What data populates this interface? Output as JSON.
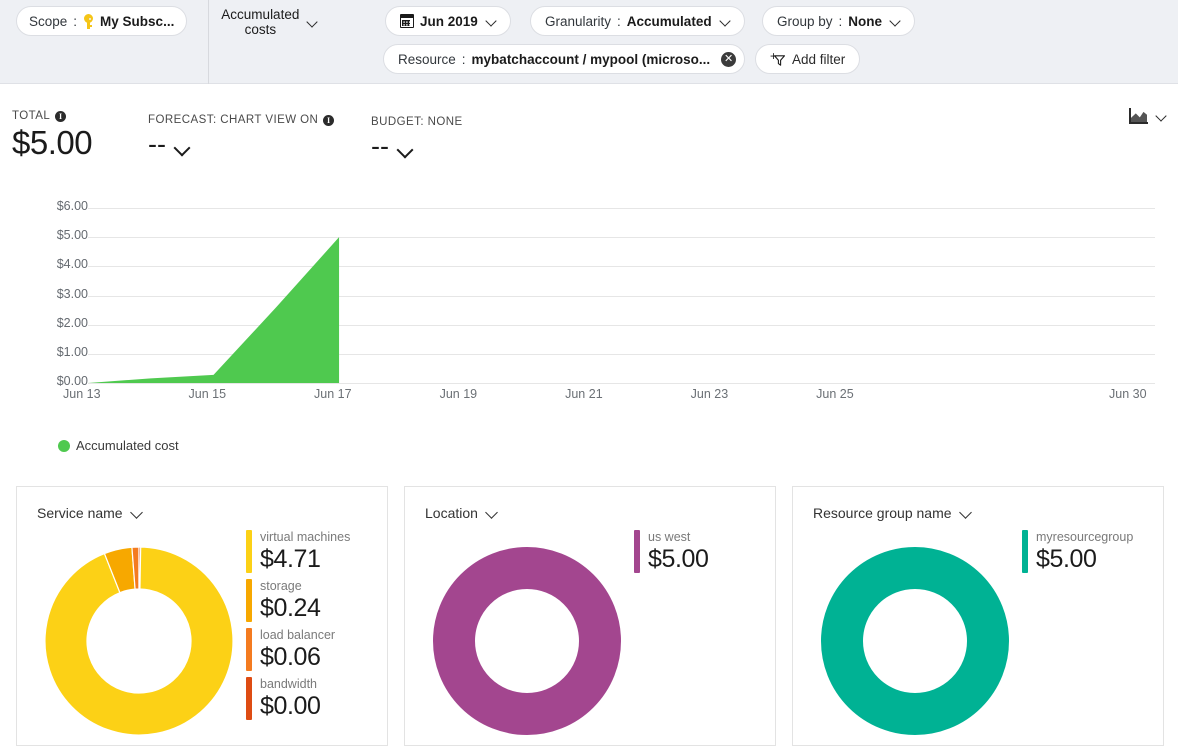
{
  "toolbar": {
    "scope": {
      "label": "Scope",
      "separator": ":",
      "value": "My Subsc...",
      "icon": "key-icon"
    },
    "view_button": {
      "label": "Accumulated costs",
      "icon": "chevron-down-icon"
    },
    "date_range": {
      "value": "Jun 2019",
      "icon": "calendar-icon"
    },
    "granularity": {
      "label": "Granularity",
      "separator": ":",
      "value": "Accumulated"
    },
    "group_by": {
      "label": "Group by",
      "separator": ":",
      "value": "None"
    },
    "resource_filter": {
      "label": "Resource",
      "separator": ":",
      "value": "mybatchaccount / mypool (microso...",
      "remove_icon": "✕"
    },
    "add_filter": {
      "label": "Add filter",
      "icon": "funnel-plus-icon"
    }
  },
  "kpis": {
    "total": {
      "caption": "TOTAL",
      "value": "$5.00",
      "info": "i"
    },
    "forecast": {
      "caption": "FORECAST: CHART VIEW ON",
      "value": "--",
      "info": "i"
    },
    "budget": {
      "caption": "BUDGET: NONE",
      "value": "--"
    }
  },
  "chart_type_selector": {
    "icon": "area-chart-icon",
    "chevron": "chevron-down-icon"
  },
  "chart_data": {
    "type": "area",
    "title": "",
    "xlabel": "",
    "ylabel": "",
    "ylim": [
      0,
      6
    ],
    "ytick_labels": [
      "$6.00",
      "$5.00",
      "$4.00",
      "$3.00",
      "$2.00",
      "$1.00",
      "$0.00"
    ],
    "ytick_values": [
      6,
      5,
      4,
      3,
      2,
      1,
      0
    ],
    "xtick_labels": [
      "Jun 13",
      "Jun 15",
      "Jun 17",
      "Jun 19",
      "Jun 21",
      "Jun 23",
      "Jun 25",
      "Jun 30"
    ],
    "xtick_days": [
      13,
      15,
      17,
      19,
      21,
      23,
      25,
      30
    ],
    "xlim_days": [
      13,
      30
    ],
    "grid": true,
    "legend_position": "bottom-left",
    "series": [
      {
        "name": "Accumulated cost",
        "color": "#4fc94f",
        "x": [
          13,
          14,
          15,
          16,
          17
        ],
        "values": [
          0.0,
          0.16,
          0.28,
          2.6,
          5.0
        ]
      }
    ],
    "legend": [
      {
        "label": "Accumulated cost",
        "color": "#4fc94f"
      }
    ]
  },
  "donut_cards": [
    {
      "title": "Service name",
      "chart_data": {
        "type": "pie",
        "categories": [
          "virtual machines",
          "storage",
          "load balancer",
          "bandwidth"
        ],
        "values": [
          4.71,
          0.24,
          0.06,
          0.0
        ],
        "value_labels": [
          "$4.71",
          "$0.24",
          "$0.06",
          "$0.00"
        ],
        "colors": [
          "#fcd116",
          "#f7a800",
          "#f47b20",
          "#de4c13"
        ],
        "total": 5.01
      }
    },
    {
      "title": "Location",
      "chart_data": {
        "type": "pie",
        "categories": [
          "us west"
        ],
        "values": [
          5.0
        ],
        "value_labels": [
          "$5.00"
        ],
        "colors": [
          "#a3468f"
        ],
        "total": 5.0
      }
    },
    {
      "title": "Resource group name",
      "chart_data": {
        "type": "pie",
        "categories": [
          "myresourcegroup"
        ],
        "values": [
          5.0
        ],
        "value_labels": [
          "$5.00"
        ],
        "colors": [
          "#00b294"
        ],
        "total": 5.0
      }
    }
  ]
}
